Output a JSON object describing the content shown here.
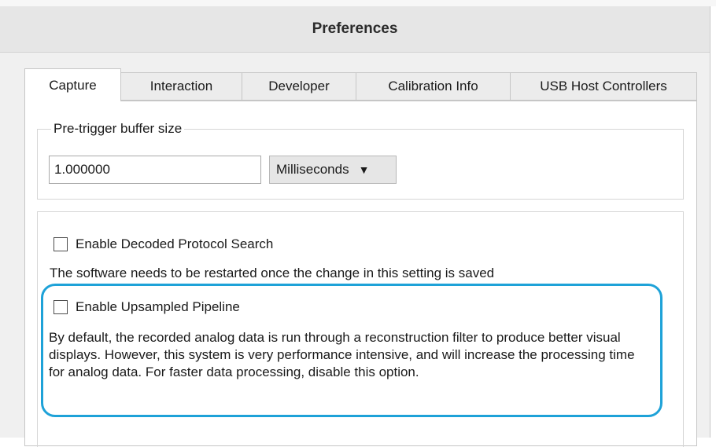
{
  "window": {
    "title": "Preferences"
  },
  "tabs": [
    {
      "label": "Capture",
      "active": true
    },
    {
      "label": "Interaction",
      "active": false
    },
    {
      "label": "Developer",
      "active": false
    },
    {
      "label": "Calibration Info",
      "active": false
    },
    {
      "label": "USB Host Controllers",
      "active": false
    }
  ],
  "pretrigger": {
    "group_title": "Pre-trigger buffer size",
    "value": "1.000000",
    "unit_selected": "Milliseconds"
  },
  "decoded_search": {
    "label": "Enable Decoded Protocol Search",
    "checked": false,
    "note": "The software needs to be restarted once the change in this setting is saved"
  },
  "upsampled": {
    "label": "Enable Upsampled Pipeline",
    "checked": false,
    "description": "By default, the recorded analog data is run through a reconstruction filter to produce better visual displays. However, this system is very performance intensive, and will increase the processing time for analog data. For faster data processing, disable this option."
  },
  "colors": {
    "highlight": "#1ea2d8",
    "titlebar": "#e6e6e6",
    "window_bg": "#f0f0f0"
  }
}
